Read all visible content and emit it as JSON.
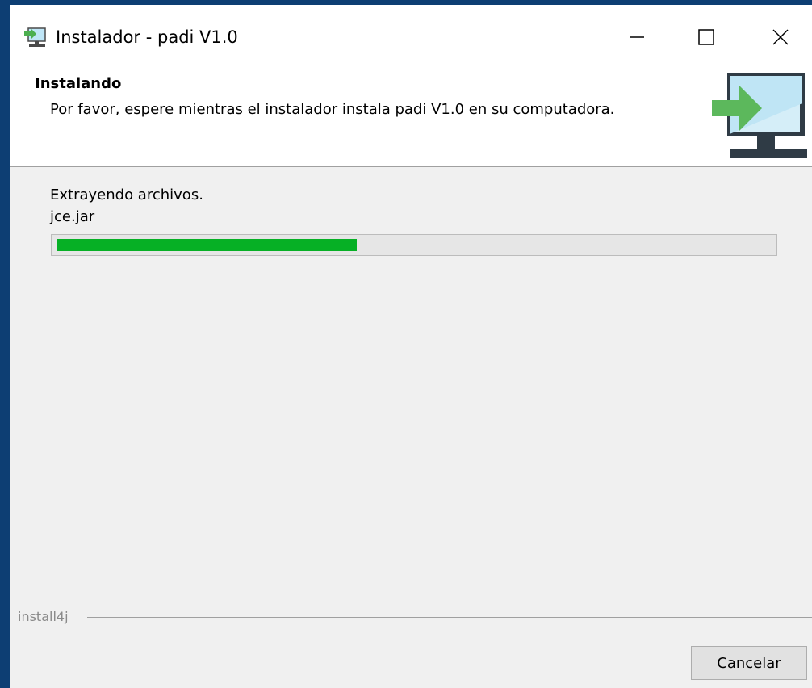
{
  "window": {
    "title": "Instalador - padi V1.0",
    "controls": {
      "minimize": "minimize-icon",
      "maximize": "maximize-icon",
      "close": "close-icon"
    }
  },
  "header": {
    "title": "Instalando",
    "description": "Por favor, espere mientras el instalador instala padi V1.0 en su computadora.",
    "icon": "install-computer-icon"
  },
  "progress": {
    "status": "Extrayendo archivos.",
    "current_file": "jce.jar",
    "fraction": 0.42,
    "color": "#06b025"
  },
  "footer": {
    "brand": "install4j",
    "cancel_label": "Cancelar"
  },
  "colors": {
    "window_border": "#0d3e73",
    "background": "#f0f0f0",
    "accent_green": "#3fb34f"
  }
}
